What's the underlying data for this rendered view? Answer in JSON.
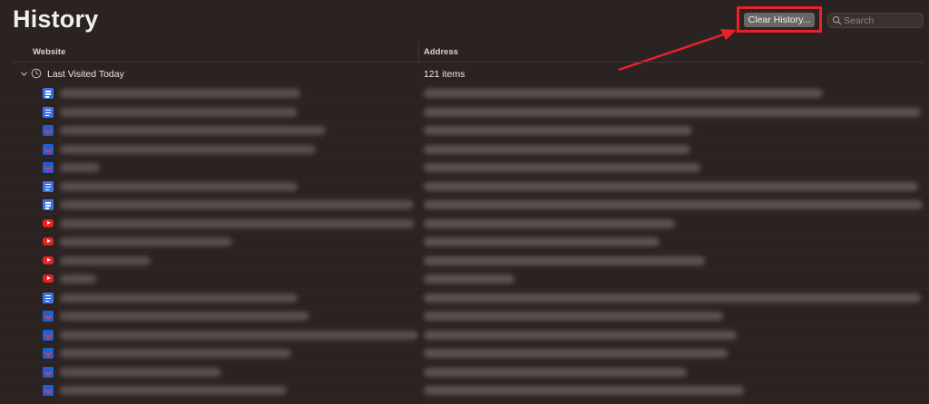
{
  "header": {
    "title": "History",
    "clear_label": "Clear History...",
    "search_placeholder": "Search"
  },
  "columns": {
    "website": "Website",
    "address": "Address"
  },
  "group": {
    "label": "Last Visited Today",
    "count": "121 items"
  },
  "rows": [
    {
      "icon": "doc"
    },
    {
      "icon": "doc"
    },
    {
      "icon": "site"
    },
    {
      "icon": "site"
    },
    {
      "icon": "site"
    },
    {
      "icon": "doc"
    },
    {
      "icon": "doc"
    },
    {
      "icon": "youtube"
    },
    {
      "icon": "youtube"
    },
    {
      "icon": "youtube"
    },
    {
      "icon": "youtube"
    },
    {
      "icon": "doc"
    },
    {
      "icon": "site"
    },
    {
      "icon": "site"
    },
    {
      "icon": "site"
    },
    {
      "icon": "site"
    },
    {
      "icon": "site"
    }
  ],
  "colors": {
    "background": "#2b2322",
    "highlight": "#e8222b",
    "button": "#6b6666"
  }
}
